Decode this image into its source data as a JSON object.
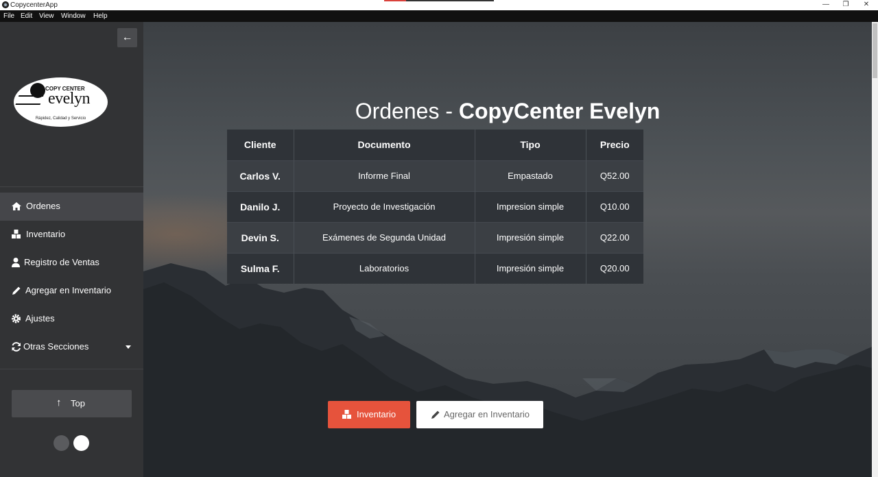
{
  "window": {
    "title": "CopycenterApp",
    "controls": {
      "minimize": "—",
      "maximize": "❐",
      "close": "✕"
    }
  },
  "menu": [
    "File",
    "Edit",
    "View",
    "Window",
    "Help"
  ],
  "sidebar": {
    "collapse_icon": "arrow-left-icon",
    "logo": {
      "top_text": "COPY CENTER",
      "name": "evelyn",
      "tagline": "Rápidez, Calidad y Servicio"
    },
    "items": [
      {
        "label": "Ordenes",
        "icon": "home-icon",
        "active": true
      },
      {
        "label": "Inventario",
        "icon": "boxes-icon",
        "active": false
      },
      {
        "label": "Registro de Ventas",
        "icon": "user-icon",
        "active": false
      },
      {
        "label": "Agregar en Inventario",
        "icon": "pencil-icon",
        "active": false
      },
      {
        "label": "Ajustes",
        "icon": "gear-icon",
        "active": false
      },
      {
        "label": "Otras Secciones",
        "icon": "refresh-icon",
        "active": false
      }
    ],
    "top_button": {
      "label": "Top",
      "icon": "arrow-up-icon"
    }
  },
  "main": {
    "heading": {
      "light": "Ordenes",
      "sep": " - ",
      "bold": "CopyCenter Evelyn"
    },
    "table": {
      "headers": [
        "Cliente",
        "Documento",
        "Tipo",
        "Precio"
      ],
      "rows": [
        [
          "Carlos V.",
          "Informe Final",
          "Empastado",
          "Q52.00"
        ],
        [
          "Danilo J.",
          "Proyecto de Investigación",
          "Impresion simple",
          "Q10.00"
        ],
        [
          "Devin S.",
          "Exámenes de Segunda Unidad",
          "Impresión simple",
          "Q22.00"
        ],
        [
          "Sulma F.",
          "Laboratorios",
          "Impresión simple",
          "Q20.00"
        ]
      ]
    },
    "buttons": {
      "primary": {
        "label": "Inventario",
        "icon": "boxes-icon",
        "color": "#e6533c"
      },
      "secondary": {
        "label": "Agregar en Inventario",
        "icon": "pencil-icon"
      }
    }
  }
}
